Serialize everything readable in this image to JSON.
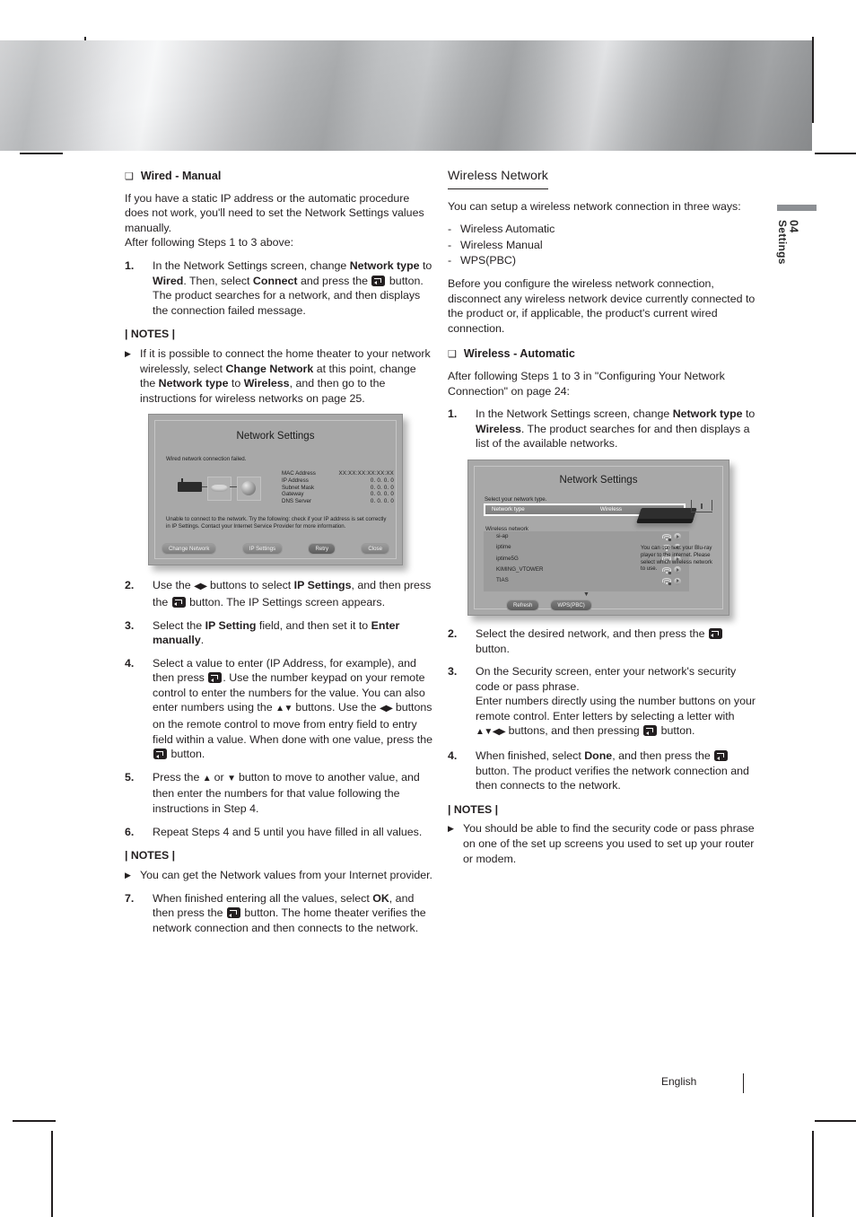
{
  "page": {
    "chapter_number": "04",
    "chapter_label": "Settings",
    "footer_language": "English"
  },
  "left_column": {
    "sub_head": "Wired - Manual",
    "intro_1": "If you have a static IP address or the automatic procedure does not work, you'll need to set the Network Settings values manually.",
    "intro_2": "After following Steps 1 to 3 above:",
    "step1_num": "1.",
    "step1_a": "In the Network Settings screen, change ",
    "step1_b1": "Network type",
    "step1_c": " to ",
    "step1_b2": "Wired",
    "step1_d": ". Then, select ",
    "step1_b3": "Connect",
    "step1_e": " and press the ",
    "step1_f": " button.",
    "step1_g": "The product searches for a network, and then displays the connection failed message.",
    "notes_title_1": "| NOTES |",
    "note_1_a": "If it is possible to connect the home theater to your network wirelessly, select ",
    "note_1_b1": "Change Network",
    "note_1_c": " at this point, change the ",
    "note_1_b2": "Network type",
    "note_1_d": " to ",
    "note_1_b3": "Wireless",
    "note_1_e": ", and then go to the instructions for wireless networks on page 25.",
    "step2_num": "2.",
    "step2_a": "Use the ",
    "step2_arrows": "◀▶",
    "step2_b": " buttons to select ",
    "step2_bold": "IP Settings",
    "step2_c": ", and then press the ",
    "step2_d": " button. The IP Settings screen appears.",
    "step3_num": "3.",
    "step3_a": "Select the ",
    "step3_b1": "IP Setting",
    "step3_b": " field, and then set it to ",
    "step3_b2": "Enter manually",
    "step3_c": ".",
    "step4_num": "4.",
    "step4_a": "Select a value to enter (IP Address, for example), and then press ",
    "step4_b": ". Use the number keypad on your remote control to enter the numbers for the value. You can also enter numbers using the ",
    "step4_arrows1": "▲▼",
    "step4_c": " buttons. Use the ",
    "step4_arrows2": "◀▶",
    "step4_d": " buttons on the remote control to move from entry field to entry field within a value. When done with one value, press the ",
    "step4_e": " button.",
    "step5_num": "5.",
    "step5_a": "Press the ",
    "step5_up": "▲",
    "step5_b": " or ",
    "step5_down": "▼",
    "step5_c": " button to move to another value, and then enter the numbers for that value following the instructions in Step 4.",
    "step6_num": "6.",
    "step6_text": "Repeat Steps 4 and 5 until you have filled in all values.",
    "notes_title_2": "| NOTES |",
    "note_2": "You can get the Network values from your Internet provider.",
    "step7_num": "7.",
    "step7_a": "When finished entering all the values, select ",
    "step7_bold": "OK",
    "step7_b": ", and then press the ",
    "step7_c": " button. The home theater verifies the network connection and then connects to the network."
  },
  "right_column": {
    "section_title": "Wireless Network",
    "intro": "You can setup a wireless network connection in three ways:",
    "ways": [
      "Wireless Automatic",
      "Wireless Manual",
      "WPS(PBC)"
    ],
    "before_note": "Before you configure the wireless network connection, disconnect any wireless network device currently connected to the product or, if applicable, the product's current wired connection.",
    "sub_head": "Wireless - Automatic",
    "after_steps": "After following Steps 1 to 3 in \"Configuring Your Network Connection\" on page 24:",
    "step1_num": "1.",
    "step1_a": "In the Network Settings screen, change ",
    "step1_b1": "Network type",
    "step1_b": " to ",
    "step1_b2": "Wireless",
    "step1_c": ". The product searches for and then displays a list of the available networks.",
    "step2_num": "2.",
    "step2_a": "Select the desired network, and then press the ",
    "step2_b": " button.",
    "step3_num": "3.",
    "step3_a": "On the Security screen, enter your network's security code or pass phrase.",
    "step3_b": "Enter numbers directly using the number buttons on your remote control. Enter letters by selecting a letter with ",
    "step3_arrows": "▲▼◀▶",
    "step3_c": " buttons, and then pressing ",
    "step3_d": " button.",
    "step4_num": "4.",
    "step4_a": "When finished, select ",
    "step4_bold": "Done",
    "step4_b": ", and then press the ",
    "step4_c": " button. The product verifies the network connection and then connects to the network.",
    "notes_title": "| NOTES |",
    "note": "You should be able to find the security code or pass phrase on one of the set up screens you used to set up your router or modem."
  },
  "dialog_wired": {
    "title": "Network Settings",
    "status": "Wired network connection failed.",
    "rows": [
      {
        "label": "MAC Address",
        "value": "XX:XX:XX:XX:XX:XX"
      },
      {
        "label": "IP Address",
        "value": "0.  0.  0.  0"
      },
      {
        "label": "Subnet Mask",
        "value": "0.  0.  0.  0"
      },
      {
        "label": "Gateway",
        "value": "0.  0.  0.  0"
      },
      {
        "label": "DNS Server",
        "value": "0.  0.  0.  0"
      }
    ],
    "help": "Unable to connect to the network. Try the following: check if your IP address is set correctly in IP Settings. Contact your Internet Service Provider for more information.",
    "buttons": [
      "Change Network",
      "IP Settings",
      "Retry",
      "Close"
    ]
  },
  "dialog_wireless": {
    "title": "Network Settings",
    "status": "Select your network type.",
    "network_type_label": "Network type",
    "network_type_value": "Wireless",
    "wireless_network_label": "Wireless network",
    "networks": [
      {
        "name": "si-ap",
        "secured": true
      },
      {
        "name": "iptime",
        "secured": false
      },
      {
        "name": "iptime5G",
        "secured": false
      },
      {
        "name": "KIMING_VTOWER",
        "secured": true
      },
      {
        "name": "TIAS",
        "secured": true
      }
    ],
    "buttons": [
      "Refresh",
      "WPS(PBC)"
    ],
    "side_text": "You can connect your Blu-ray player to the internet. Please select which wireless network to use."
  }
}
